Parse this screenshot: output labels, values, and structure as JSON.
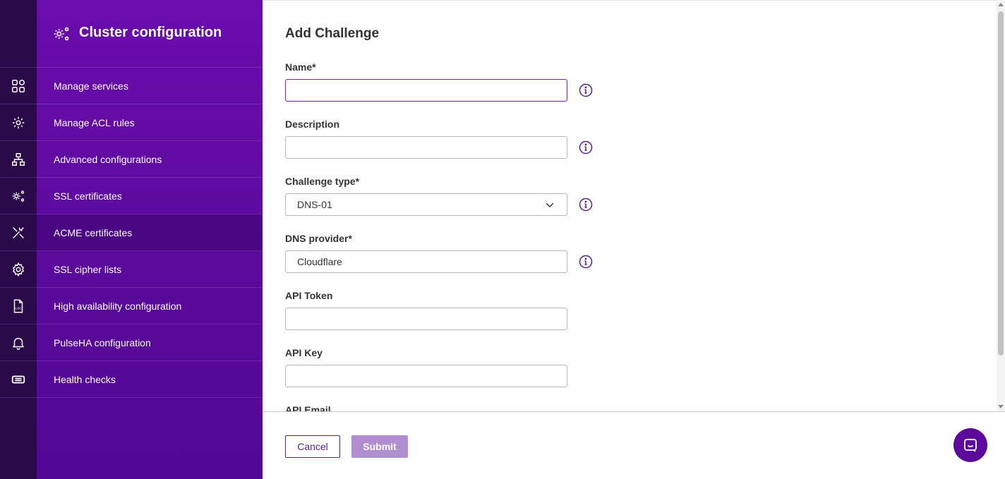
{
  "sidebar": {
    "title": "Cluster configuration",
    "items": [
      {
        "label": "Manage services",
        "icon": "grid-icon"
      },
      {
        "label": "Manage ACL rules",
        "icon": "gear-network-icon"
      },
      {
        "label": "Advanced configurations",
        "icon": "sitemap-icon"
      },
      {
        "label": "SSL certificates",
        "icon": "gears-icon"
      },
      {
        "label": "ACME certificates",
        "icon": "tools-icon",
        "active": true
      },
      {
        "label": "SSL cipher lists",
        "icon": "gear-icon"
      },
      {
        "label": "High availability configuration",
        "icon": "log-file-icon"
      },
      {
        "label": "PulseHA configuration",
        "icon": "bell-icon"
      },
      {
        "label": "Health checks",
        "icon": "ticket-icon"
      }
    ]
  },
  "form": {
    "title": "Add Challenge",
    "name_label": "Name*",
    "name_value": "",
    "description_label": "Description",
    "description_value": "",
    "challenge_type_label": "Challenge type*",
    "challenge_type_value": "DNS-01",
    "dns_provider_label": "DNS provider*",
    "dns_provider_value": "Cloudflare",
    "api_token_label": "API Token",
    "api_token_value": "",
    "api_key_label": "API Key",
    "api_key_value": "",
    "api_email_label": "API Email",
    "api_email_value": ""
  },
  "footer": {
    "cancel_label": "Cancel",
    "submit_label": "Submit"
  },
  "colors": {
    "sidebar": "#5b0a9c",
    "rail": "#2a0a4a",
    "accent": "#5a1f8c",
    "submit_disabled": "#b08ed0"
  }
}
